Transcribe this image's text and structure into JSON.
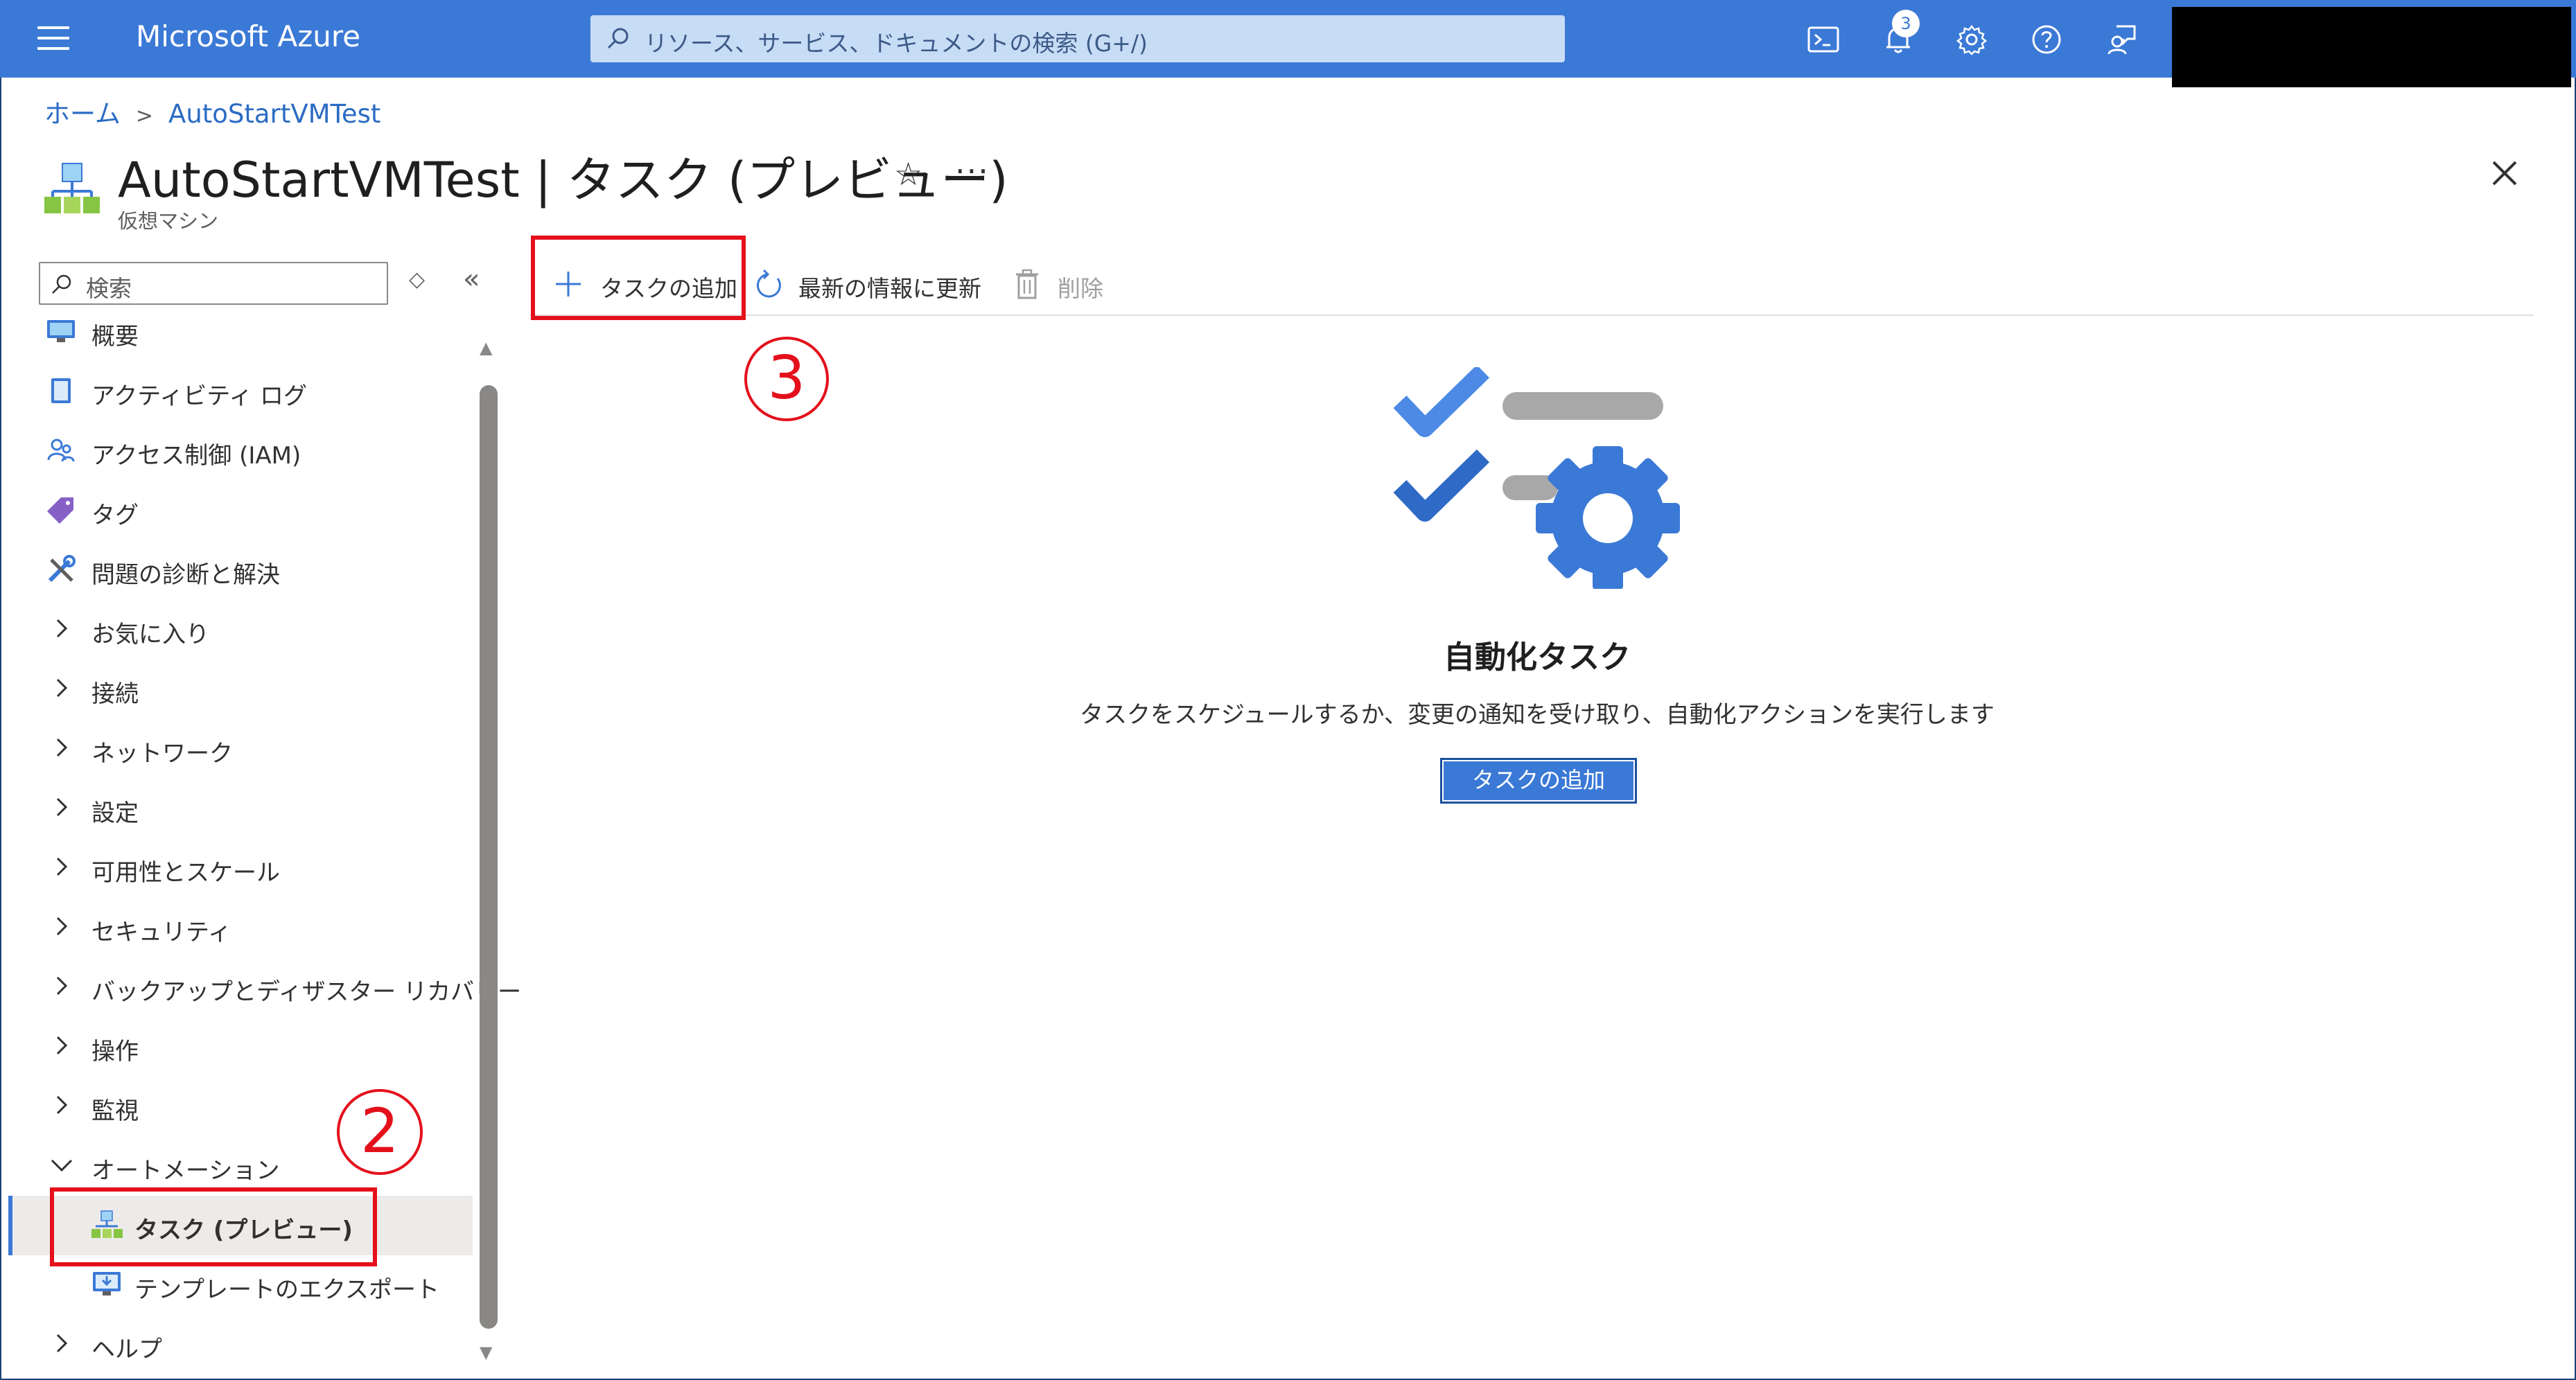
{
  "topbar": {
    "brand": "Microsoft Azure",
    "search_placeholder": "リソース、サービス、ドキュメントの検索 (G+/)",
    "notification_count": "3",
    "icons": [
      "terminal-icon",
      "bell-icon",
      "gear-icon",
      "help-icon",
      "feedback-icon"
    ]
  },
  "breadcrumb": {
    "items": [
      "ホーム",
      "AutoStartVMTest"
    ],
    "separator": ">"
  },
  "header": {
    "title": "AutoStartVMTest | タスク (プレビュー)",
    "subtitle": "仮想マシン",
    "star": "☆",
    "more": "···"
  },
  "sidebar": {
    "search_placeholder": "検索",
    "updown": "◇",
    "collapse": "«",
    "items": [
      {
        "label": "概要",
        "type": "icon",
        "icon": "monitor-icon"
      },
      {
        "label": "アクティビティ ログ",
        "type": "icon",
        "icon": "log-icon"
      },
      {
        "label": "アクセス制御 (IAM)",
        "type": "icon",
        "icon": "people-icon"
      },
      {
        "label": "タグ",
        "type": "icon",
        "icon": "tag-icon"
      },
      {
        "label": "問題の診断と解決",
        "type": "icon",
        "icon": "wrench-icon"
      },
      {
        "label": "お気に入り",
        "type": "group",
        "expanded": false
      },
      {
        "label": "接続",
        "type": "group",
        "expanded": false
      },
      {
        "label": "ネットワーク",
        "type": "group",
        "expanded": false
      },
      {
        "label": "設定",
        "type": "group",
        "expanded": false
      },
      {
        "label": "可用性とスケール",
        "type": "group",
        "expanded": false
      },
      {
        "label": "セキュリティ",
        "type": "group",
        "expanded": false
      },
      {
        "label": "バックアップとディザスター リカバリー",
        "type": "group",
        "expanded": false
      },
      {
        "label": "操作",
        "type": "group",
        "expanded": false
      },
      {
        "label": "監視",
        "type": "group",
        "expanded": false
      },
      {
        "label": "オートメーション",
        "type": "group",
        "expanded": true
      },
      {
        "label": "タスク (プレビュー)",
        "type": "sub",
        "icon": "tasks-icon",
        "selected": true
      },
      {
        "label": "テンプレートのエクスポート",
        "type": "sub",
        "icon": "export-template-icon"
      },
      {
        "label": "ヘルプ",
        "type": "group",
        "expanded": false
      }
    ]
  },
  "toolbar": {
    "add_task": "タスクの追加",
    "refresh": "最新の情報に更新",
    "delete": "削除"
  },
  "annotations": {
    "step2": "2",
    "step3": "3",
    "color": "#e4101b"
  },
  "empty_state": {
    "title": "自動化タスク",
    "description": "タスクをスケジュールするか、変更の通知を受け取り、自動化アクションを実行します",
    "button": "タスクの追加"
  },
  "colors": {
    "azure_blue": "#3b79d6",
    "link_blue": "#2b6cc4",
    "selected_bg": "#edebe9"
  }
}
